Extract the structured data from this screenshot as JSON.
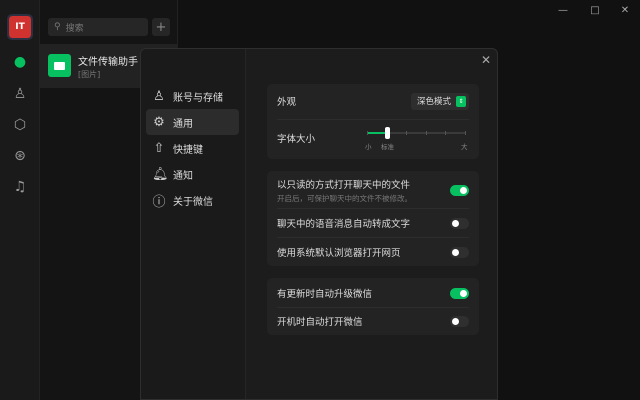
{
  "app": {
    "logo_text": "IT",
    "accent": "#07c160"
  },
  "nav": {
    "icons": [
      "chat-icon",
      "contacts-icon",
      "box-icon",
      "moments-icon",
      "music-icon"
    ]
  },
  "chatlist": {
    "search_placeholder": "搜索",
    "add_label": "+",
    "chats": [
      {
        "name": "文件传输助手",
        "preview": "[图片]"
      }
    ]
  },
  "window": {
    "minimize": "—",
    "maximize": "□",
    "close": "✕"
  },
  "settings": {
    "close": "✕",
    "menu": [
      {
        "label": "账号与存储",
        "icon": "user-icon",
        "active": false
      },
      {
        "label": "通用",
        "icon": "gear-icon",
        "active": true
      },
      {
        "label": "快捷键",
        "icon": "shortcut-icon",
        "active": false
      },
      {
        "label": "通知",
        "icon": "bell-icon",
        "active": false
      },
      {
        "label": "关于微信",
        "icon": "info-icon",
        "active": false
      }
    ],
    "appearance": {
      "label": "外观",
      "value": "深色模式"
    },
    "font_size": {
      "label": "字体大小",
      "min_label": "小",
      "std_label": "标准",
      "max_label": "大",
      "level": 1,
      "steps": 6
    },
    "group2": [
      {
        "label": "以只读的方式打开聊天中的文件",
        "sub": "开启后，可保护聊天中的文件不被修改。",
        "on": true
      },
      {
        "label": "聊天中的语音消息自动转成文字",
        "on": false
      },
      {
        "label": "使用系统默认浏览器打开网页",
        "on": false
      }
    ],
    "group3": [
      {
        "label": "有更新时自动升级微信",
        "on": true
      },
      {
        "label": "开机时自动打开微信",
        "on": false
      }
    ]
  }
}
